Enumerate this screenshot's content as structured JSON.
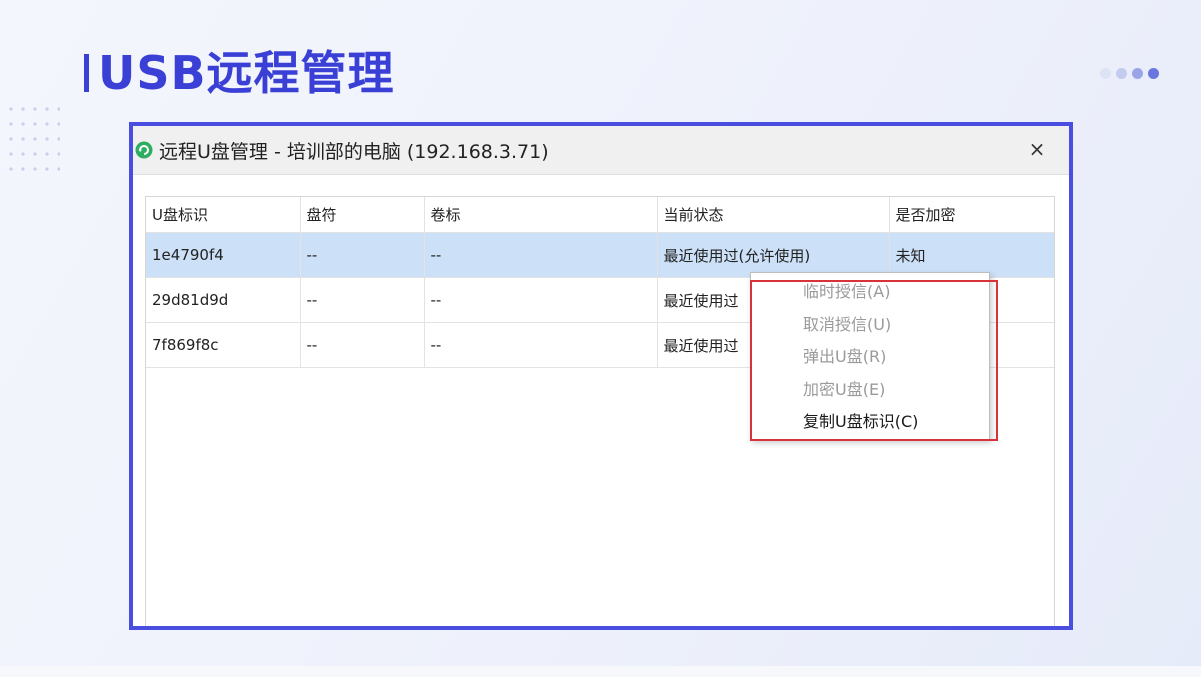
{
  "slide": {
    "title": "USB远程管理",
    "accent_color": "#3a3fd6",
    "highlight_color": "#d8323a"
  },
  "window": {
    "title": "远程U盘管理 - 培训部的电脑 (192.168.3.71)",
    "close_label": "×",
    "icon": "refresh-circle-icon"
  },
  "table": {
    "columns": [
      "U盘标识",
      "盘符",
      "卷标",
      "当前状态",
      "是否加密"
    ],
    "rows": [
      [
        "1e4790f4",
        "--",
        "--",
        "最近使用过(允许使用)",
        "未知"
      ],
      [
        "29d81d9d",
        "--",
        "--",
        "最近使用过",
        ""
      ],
      [
        "7f869f8c",
        "--",
        "--",
        "最近使用过",
        ""
      ]
    ],
    "selected_row": 0
  },
  "context_menu": {
    "items": [
      {
        "label": "临时授信(A)",
        "enabled": false
      },
      {
        "label": "取消授信(U)",
        "enabled": false
      },
      {
        "label": "弹出U盘(R)",
        "enabled": false
      },
      {
        "label": "加密U盘(E)",
        "enabled": false
      },
      {
        "label": "复制U盘标识(C)",
        "enabled": true
      }
    ]
  }
}
